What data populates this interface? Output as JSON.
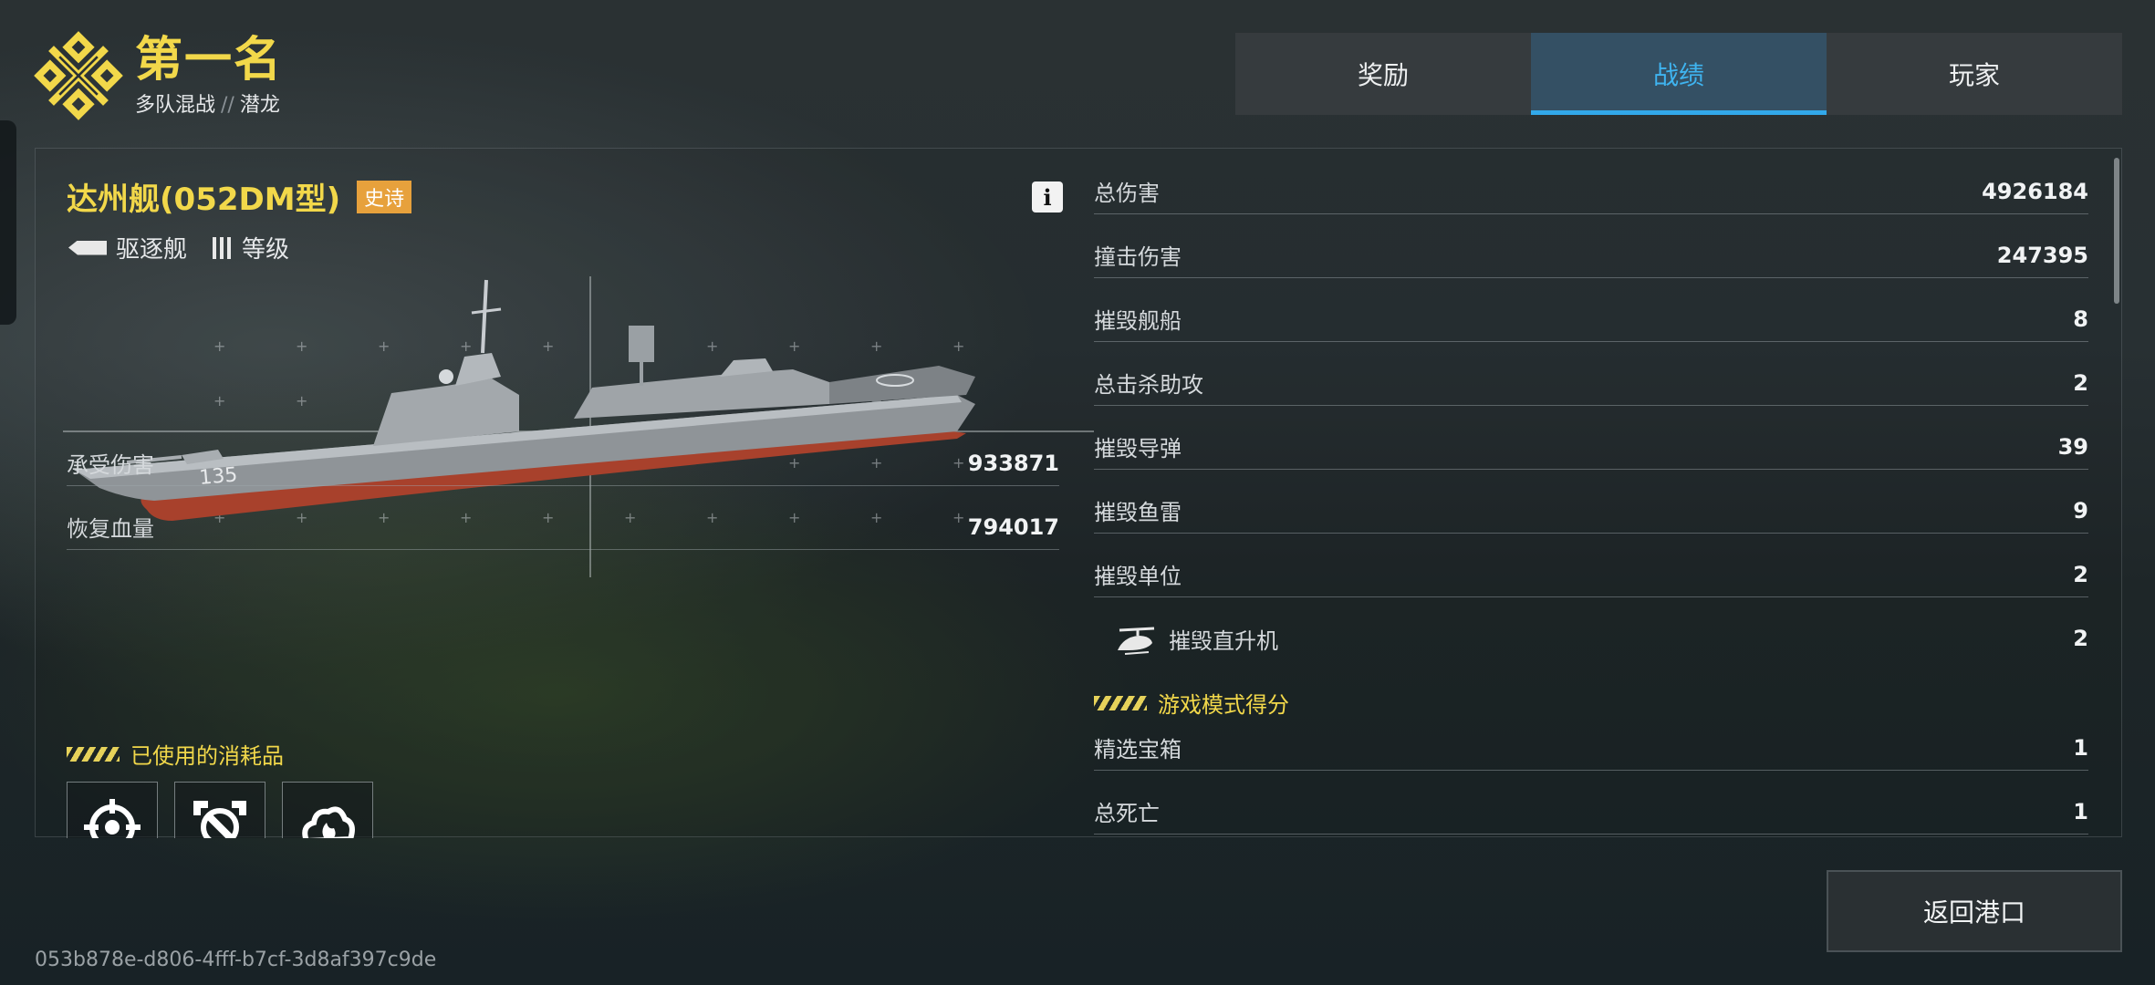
{
  "header": {
    "rank_title": "第一名",
    "mode": "多队混战",
    "separator": "//",
    "map": "潜龙"
  },
  "tabs": [
    {
      "label": "奖励",
      "active": false
    },
    {
      "label": "战绩",
      "active": true
    },
    {
      "label": "玩家",
      "active": false
    }
  ],
  "ship": {
    "name": "达州舰(052DM型)",
    "rarity": "史诗",
    "class": "驱逐舰",
    "tier_label": "等级",
    "hull_number": "135",
    "info_icon": "info-icon"
  },
  "left_stats": [
    {
      "label": "承受伤害",
      "value": "933871"
    },
    {
      "label": "恢复血量",
      "value": "794017"
    }
  ],
  "consumables": {
    "title": "已使用的消耗品",
    "items": [
      "target-lock-icon",
      "repair-wrench-icon",
      "fire-extinguish-icon"
    ]
  },
  "stats": [
    {
      "label": "总伤害",
      "value": "4926184"
    },
    {
      "label": "撞击伤害",
      "value": "247395"
    },
    {
      "label": "摧毁舰船",
      "value": "8"
    },
    {
      "label": "总击杀助攻",
      "value": "2"
    },
    {
      "label": "摧毁导弹",
      "value": "39"
    },
    {
      "label": "摧毁鱼雷",
      "value": "9"
    },
    {
      "label": "摧毁单位",
      "value": "2"
    },
    {
      "label": "摧毁直升机",
      "value": "2",
      "icon": "helicopter-icon"
    }
  ],
  "game_mode": {
    "title": "游戏模式得分",
    "stats": [
      {
        "label": "精选宝箱",
        "value": "1"
      },
      {
        "label": "总死亡",
        "value": "1"
      }
    ]
  },
  "footer": {
    "return_button": "返回港口",
    "match_id": "053b878e-d806-4fff-b7cf-3d8af397c9de"
  },
  "colors": {
    "accent_gold": "#f2d84a",
    "accent_blue": "#32a8ea",
    "rarity_orange": "#e7a13c"
  }
}
